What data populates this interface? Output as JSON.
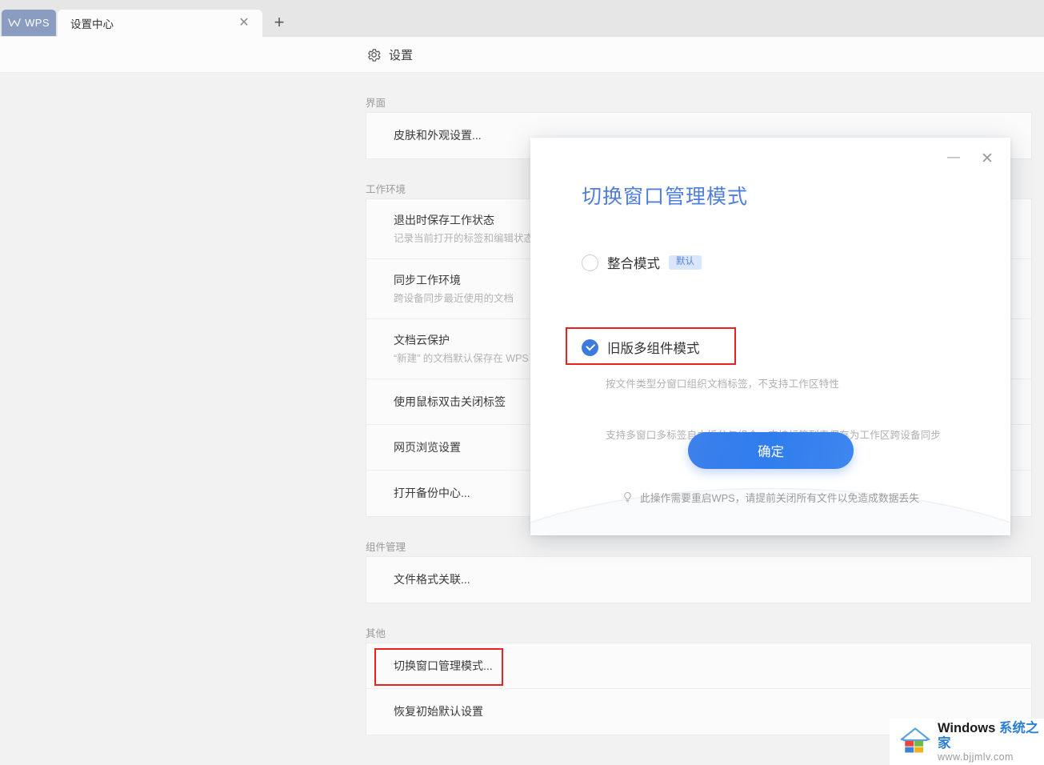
{
  "tabbar": {
    "wps_button": "WPS",
    "tab_label": "设置中心",
    "close_icon": "✕",
    "add_icon": "+"
  },
  "header": {
    "title": "设置",
    "gear_icon": "gear-icon"
  },
  "settings": {
    "groups": [
      {
        "label": "界面",
        "rows": [
          {
            "title": "皮肤和外观设置...",
            "sub": ""
          }
        ]
      },
      {
        "label": "工作环境",
        "rows": [
          {
            "title": "退出时保存工作状态",
            "sub": "记录当前打开的标签和编辑状态"
          },
          {
            "title": "同步工作环境",
            "sub": "跨设备同步最近使用的文档"
          },
          {
            "title": "文档云保护",
            "sub": "“新建” 的文档默认保存在 WPS"
          },
          {
            "title": "使用鼠标双击关闭标签",
            "sub": ""
          },
          {
            "title": "网页浏览设置",
            "sub": ""
          },
          {
            "title": "打开备份中心...",
            "sub": ""
          }
        ]
      },
      {
        "label": "组件管理",
        "rows": [
          {
            "title": "文件格式关联...",
            "sub": ""
          }
        ]
      },
      {
        "label": "其他",
        "rows": [
          {
            "title": "切换窗口管理模式...",
            "sub": ""
          },
          {
            "title": "恢复初始默认设置",
            "sub": ""
          }
        ]
      }
    ]
  },
  "dialog": {
    "title": "切换窗口管理模式",
    "minimize_icon": "—",
    "close_icon": "✕",
    "options": [
      {
        "label": "整合模式",
        "badge": "默认",
        "desc": "支持多窗口多标签自由拆分与组合，支持标签列表保存为工作区跨设备同步",
        "selected": false
      },
      {
        "label": "旧版多组件模式",
        "badge": "",
        "desc": "按文件类型分窗口组织文档标签，不支持工作区特性",
        "selected": true
      }
    ],
    "confirm_label": "确定",
    "footer_note": "此操作需要重启WPS，请提前关闭所有文件以免造成数据丢失",
    "footer_icon": "lightbulb-icon"
  },
  "watermark": {
    "brand_en": "Windows ",
    "brand_cn": "系统之家",
    "url": "www.bjjmlv.com"
  },
  "colors": {
    "accent_blue": "#3d7ae0",
    "title_blue": "#4f7ede",
    "badge_bg": "#d9e6fb",
    "highlight_red": "#e8231f",
    "page_bg": "#f2f2f2"
  }
}
